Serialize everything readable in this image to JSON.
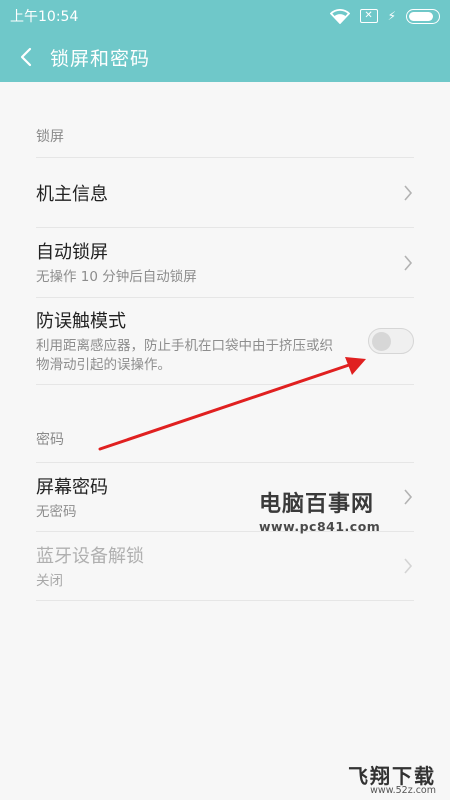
{
  "status_bar": {
    "time": "上午10:54",
    "sim_glyph": "✕",
    "battery_level": 0.88
  },
  "app_bar": {
    "title": "锁屏和密码"
  },
  "sections": [
    {
      "header": "锁屏",
      "rows": [
        {
          "title": "机主信息",
          "subtitle": ""
        },
        {
          "title": "自动锁屏",
          "subtitle": "无操作 10 分钟后自动锁屏"
        },
        {
          "title": "防误触模式",
          "subtitle": "利用距离感应器，防止手机在口袋中由于挤压或织物滑动引起的误操作。",
          "toggle_on": false
        }
      ]
    },
    {
      "header": "密码",
      "rows": [
        {
          "title": "屏幕密码",
          "subtitle": "无密码"
        },
        {
          "title": "蓝牙设备解锁",
          "subtitle": "关闭",
          "disabled": true
        }
      ]
    }
  ],
  "watermarks": {
    "mid_title": "电脑百事网",
    "mid_url": "www.pc841.com",
    "bottom_title": "飞翔下载",
    "bottom_url": "www.52z.com"
  },
  "colors": {
    "accent": "#6fc8c9",
    "annotation_arrow": "#e02020"
  },
  "icons": {
    "back": "back-arrow-icon",
    "chevron": "chevron-right-icon",
    "wifi": "wifi-icon",
    "battery": "battery-icon",
    "charging": "charging-bolt-icon"
  }
}
